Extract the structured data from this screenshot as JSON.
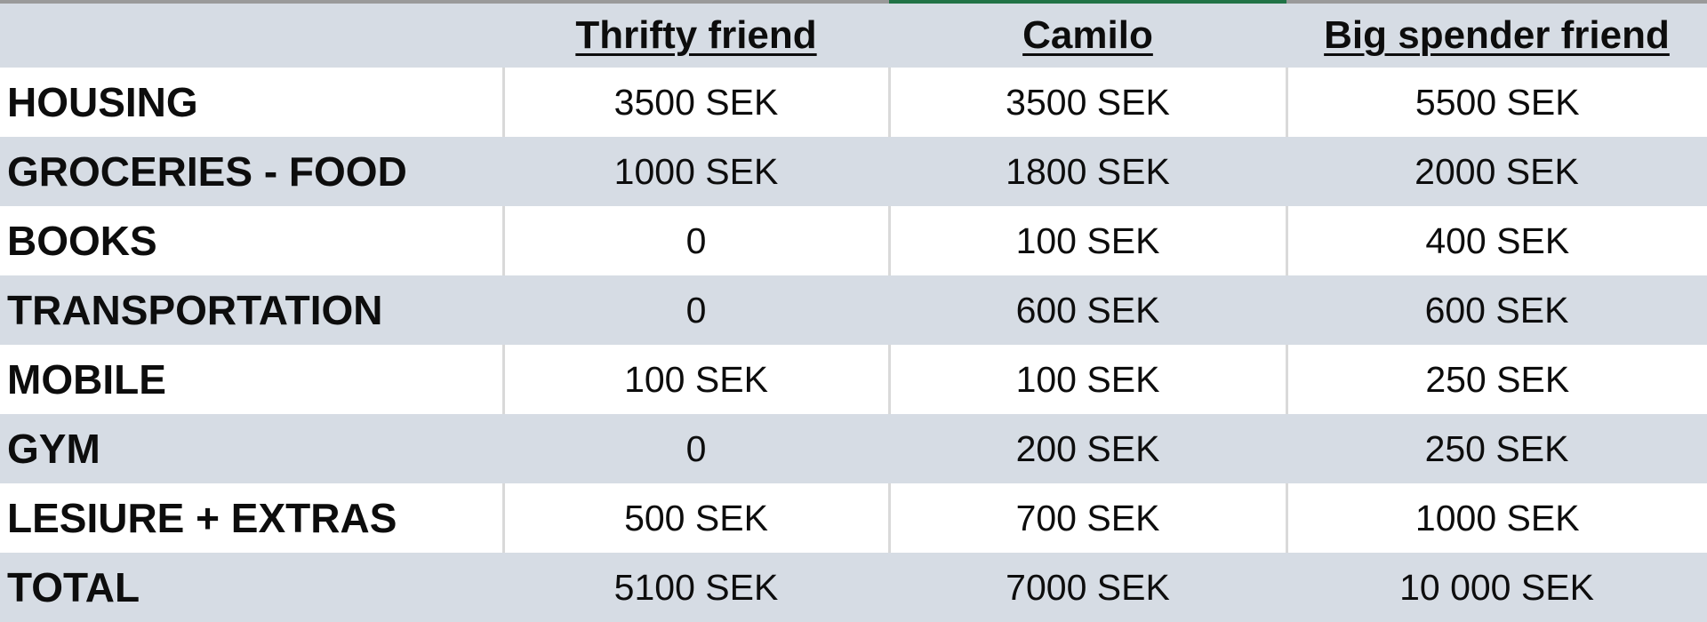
{
  "table": {
    "columns": [
      "",
      "Thrifty friend",
      "Camilo",
      "Big spender friend"
    ],
    "rows": [
      {
        "category": "HOUSING",
        "values": [
          "3500 SEK",
          "3500 SEK",
          "5500 SEK"
        ]
      },
      {
        "category": "GROCERIES - FOOD",
        "values": [
          "1000 SEK",
          "1800 SEK",
          "2000 SEK"
        ]
      },
      {
        "category": "BOOKS",
        "values": [
          "0",
          "100 SEK",
          "400 SEK"
        ]
      },
      {
        "category": "TRANSPORTATION",
        "values": [
          "0",
          "600 SEK",
          "600 SEK"
        ]
      },
      {
        "category": "MOBILE",
        "values": [
          "100 SEK",
          "100 SEK",
          "250 SEK"
        ]
      },
      {
        "category": "GYM",
        "values": [
          "0",
          "200 SEK",
          "250 SEK"
        ]
      },
      {
        "category": "LESIURE + EXTRAS",
        "values": [
          "500 SEK",
          "700 SEK",
          "1000 SEK"
        ]
      },
      {
        "category": "TOTAL",
        "values": [
          "5100 SEK",
          "7000 SEK",
          "10 000 SEK"
        ]
      }
    ]
  },
  "colors": {
    "band": "#d6dce4",
    "selection_accent": "#217346"
  }
}
